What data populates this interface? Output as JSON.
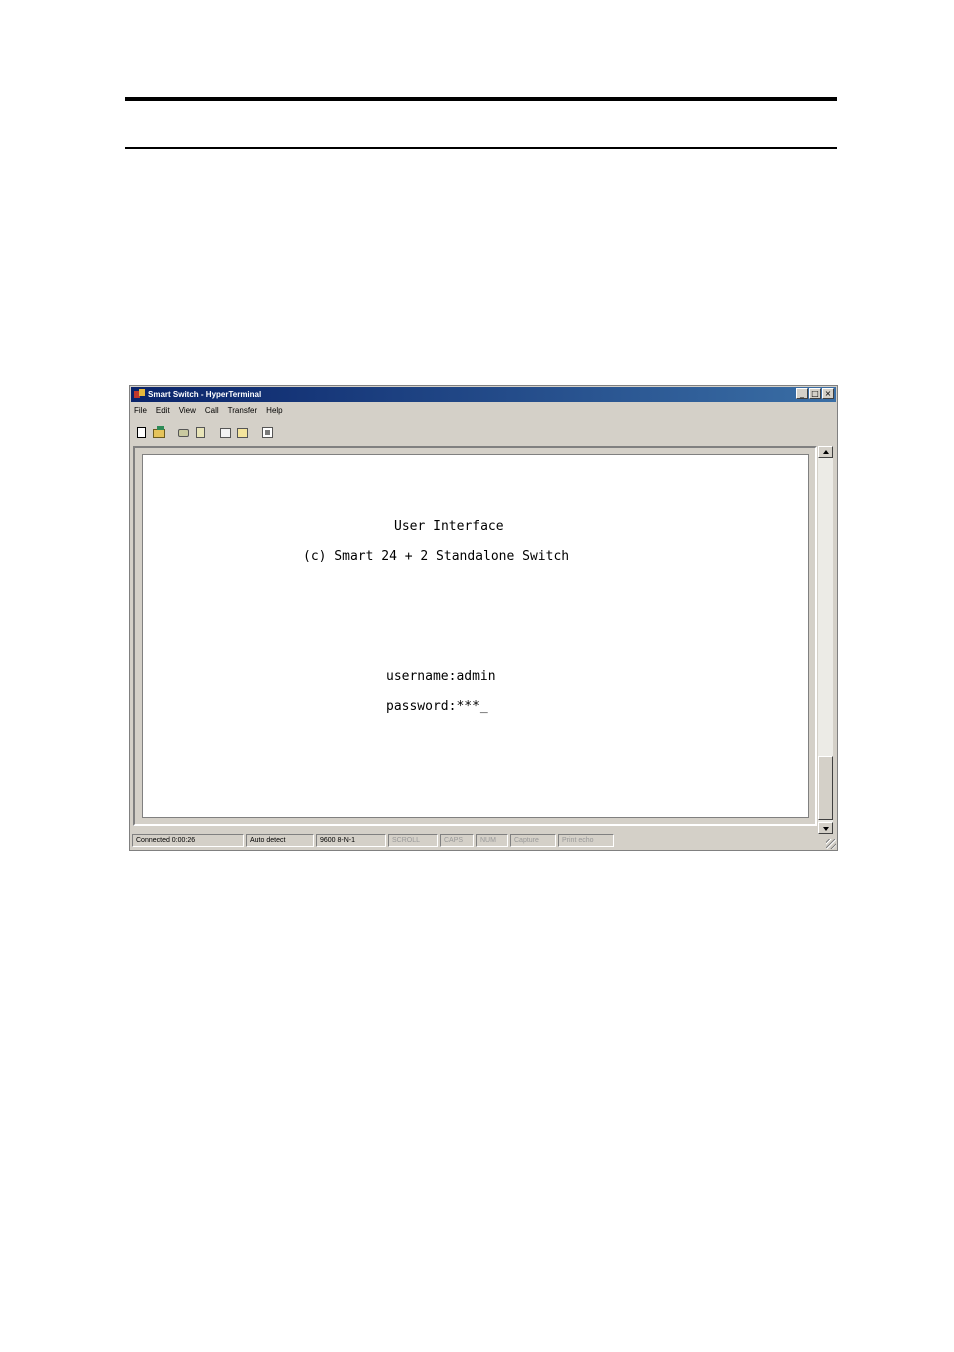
{
  "window": {
    "title": "Smart Switch - HyperTerminal",
    "controls": {
      "minimize": "_",
      "maximize": "□",
      "close": "×"
    }
  },
  "menu": {
    "items": [
      "File",
      "Edit",
      "View",
      "Call",
      "Transfer",
      "Help"
    ]
  },
  "toolbar": {
    "buttons": [
      {
        "icon": "new-document-icon"
      },
      {
        "icon": "open-folder-icon"
      },
      {
        "icon": "connect-icon"
      },
      {
        "icon": "disconnect-icon"
      },
      {
        "icon": "send-file-icon"
      },
      {
        "icon": "receive-file-icon"
      },
      {
        "icon": "properties-icon"
      }
    ]
  },
  "terminal": {
    "heading": "User Interface",
    "subheading": "(c) Smart 24 + 2 Standalone Switch",
    "username_line": "username:admin",
    "password_line": "password:***_"
  },
  "status": {
    "connected": "Connected 0:00:26",
    "detect": "Auto detect",
    "settings": "9600 8-N-1",
    "scroll": "SCROLL",
    "caps": "CAPS",
    "num": "NUM",
    "capture": "Capture",
    "print_echo": "Print echo"
  }
}
